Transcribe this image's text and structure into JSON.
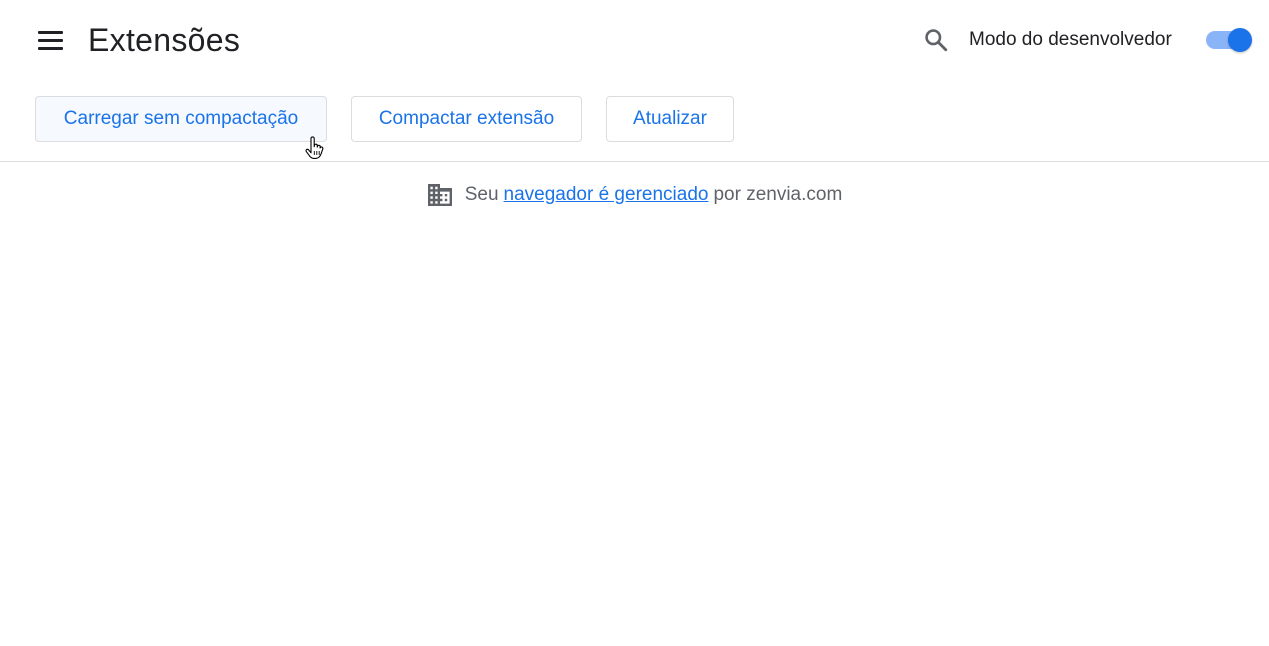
{
  "header": {
    "menu_icon": "hamburger-menu-icon",
    "title": "Extensões",
    "search_icon": "search-icon",
    "dev_mode_label": "Modo do desenvolvedor",
    "dev_mode_enabled": true,
    "toggle_color": "#1a73e8"
  },
  "toolbar": {
    "load_unpacked_label": "Carregar sem compactação",
    "pack_extension_label": "Compactar extensão",
    "update_label": "Atualizar"
  },
  "managed_notice": {
    "icon": "building-icon",
    "prefix": "Seu",
    "link_text": "navegador é gerenciado",
    "suffix": "por zenvia.com"
  },
  "colors": {
    "accent": "#1a73e8",
    "text": "#202124",
    "secondary_text": "#5f6368"
  }
}
